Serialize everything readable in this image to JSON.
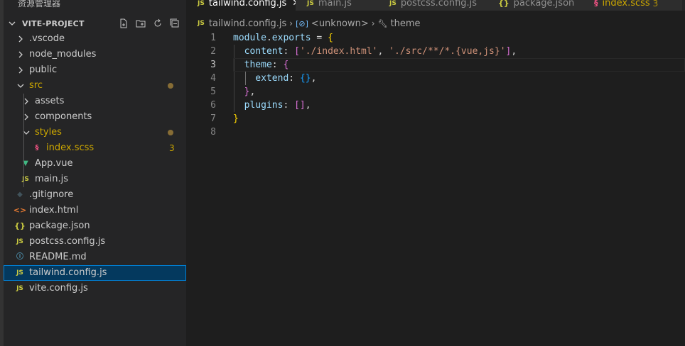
{
  "sidebar": {
    "title": "资源管理器",
    "more": "···",
    "project": "VITE-PROJECT",
    "tree": [
      {
        "label": ".vscode",
        "type": "folder",
        "depth": 0,
        "open": false
      },
      {
        "label": "node_modules",
        "type": "folder",
        "depth": 0,
        "open": false
      },
      {
        "label": "public",
        "type": "folder",
        "depth": 0,
        "open": false
      },
      {
        "label": "src",
        "type": "folder",
        "depth": 0,
        "open": true,
        "modified": true
      },
      {
        "label": "assets",
        "type": "folder",
        "depth": 1,
        "open": false
      },
      {
        "label": "components",
        "type": "folder",
        "depth": 1,
        "open": false
      },
      {
        "label": "styles",
        "type": "folder",
        "depth": 1,
        "open": true,
        "modified": true
      },
      {
        "label": "index.scss",
        "type": "scss",
        "depth": 2,
        "badge": "3",
        "modified": true
      },
      {
        "label": "App.vue",
        "type": "vue",
        "depth": 1
      },
      {
        "label": "main.js",
        "type": "js",
        "depth": 1
      },
      {
        "label": ".gitignore",
        "type": "git",
        "depth": 0
      },
      {
        "label": "index.html",
        "type": "html",
        "depth": 0
      },
      {
        "label": "package.json",
        "type": "json",
        "depth": 0
      },
      {
        "label": "postcss.config.js",
        "type": "js",
        "depth": 0
      },
      {
        "label": "README.md",
        "type": "info",
        "depth": 0
      },
      {
        "label": "tailwind.config.js",
        "type": "js",
        "depth": 0,
        "selected": true
      },
      {
        "label": "vite.config.js",
        "type": "js",
        "depth": 0
      }
    ]
  },
  "tabs": [
    {
      "label": "tailwind.config.js",
      "icon": "JS",
      "active": true
    },
    {
      "label": "main.js",
      "icon": "JS"
    },
    {
      "label": "postcss.config.js",
      "icon": "JS"
    },
    {
      "label": "package.json",
      "icon": "{}"
    },
    {
      "label": "index.scss",
      "icon": "scss",
      "count": "3",
      "error": true
    }
  ],
  "breadcrumb": {
    "file": "tailwind.config.js",
    "unknown": "<unknown>",
    "symbol": "theme"
  },
  "editor": {
    "current_line": 3,
    "line_numbers": [
      "1",
      "2",
      "3",
      "4",
      "5",
      "6",
      "7",
      "8"
    ],
    "lines": [
      [
        {
          "t": "module",
          "c": "t-var"
        },
        {
          "t": ".",
          "c": "t-op"
        },
        {
          "t": "exports",
          "c": "t-var"
        },
        {
          "t": " = ",
          "c": "t-op"
        },
        {
          "t": "{",
          "c": "t-b1"
        }
      ],
      [
        {
          "t": "  content",
          "c": "t-key"
        },
        {
          "t": ": ",
          "c": "t-op"
        },
        {
          "t": "[",
          "c": "t-b2"
        },
        {
          "t": "'./index.html'",
          "c": "t-str"
        },
        {
          "t": ", ",
          "c": "t-op"
        },
        {
          "t": "'./src/**/*.{vue,js}'",
          "c": "t-str"
        },
        {
          "t": "]",
          "c": "t-b2"
        },
        {
          "t": ",",
          "c": "t-op"
        }
      ],
      [
        {
          "t": "  theme",
          "c": "t-key"
        },
        {
          "t": ": ",
          "c": "t-op"
        },
        {
          "t": "{",
          "c": "t-b2"
        }
      ],
      [
        {
          "t": "    extend",
          "c": "t-key"
        },
        {
          "t": ": ",
          "c": "t-op"
        },
        {
          "t": "{}",
          "c": "t-b3"
        },
        {
          "t": ",",
          "c": "t-op"
        }
      ],
      [
        {
          "t": "  ",
          "c": "t-op"
        },
        {
          "t": "}",
          "c": "t-b2"
        },
        {
          "t": ",",
          "c": "t-op"
        }
      ],
      [
        {
          "t": "  plugins",
          "c": "t-key"
        },
        {
          "t": ": ",
          "c": "t-op"
        },
        {
          "t": "[]",
          "c": "t-b2"
        },
        {
          "t": ",",
          "c": "t-op"
        }
      ],
      [
        {
          "t": "}",
          "c": "t-b1"
        }
      ],
      []
    ]
  },
  "colors": {
    "selection_bg": "#04395e",
    "modified": "#cca700",
    "js_icon": "#cbcb41"
  }
}
